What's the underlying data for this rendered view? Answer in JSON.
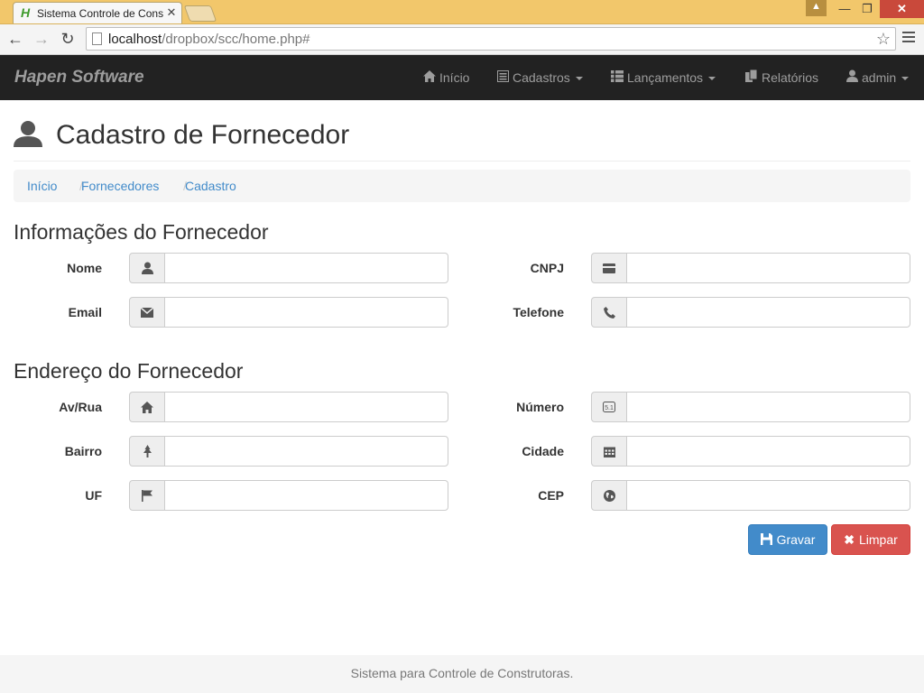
{
  "browser": {
    "tab_title": "Sistema Controle de Cons",
    "tab_favicon": "H",
    "url_host": "localhost",
    "url_path": "/dropbox/scc/home.php#"
  },
  "navbar": {
    "brand": "Hapen Software",
    "items": [
      {
        "label": "Início",
        "icon": "home-icon"
      },
      {
        "label": "Cadastros",
        "icon": "list-alt-icon"
      },
      {
        "label": "Lançamentos",
        "icon": "th-list-icon"
      },
      {
        "label": "Relatórios",
        "icon": "duplicate-icon"
      },
      {
        "label": "admin",
        "icon": "user-icon"
      }
    ]
  },
  "page": {
    "title": "Cadastro de Fornecedor"
  },
  "breadcrumb": [
    "Início",
    "Fornecedores",
    "Cadastro"
  ],
  "sections": {
    "info_title": "Informações do Fornecedor",
    "address_title": "Endereço do Fornecedor"
  },
  "fields": {
    "nome": {
      "label": "Nome",
      "value": "",
      "icon": "user-icon"
    },
    "cnpj": {
      "label": "CNPJ",
      "value": "",
      "icon": "credit-card-icon"
    },
    "email": {
      "label": "Email",
      "value": "",
      "icon": "envelope-icon"
    },
    "telefone": {
      "label": "Telefone",
      "value": "",
      "icon": "phone-icon"
    },
    "rua": {
      "label": "Av/Rua",
      "value": "",
      "icon": "home-icon"
    },
    "numero": {
      "label": "Número",
      "value": "",
      "icon": "sound-5-1-icon"
    },
    "bairro": {
      "label": "Bairro",
      "value": "",
      "icon": "tree-icon"
    },
    "cidade": {
      "label": "Cidade",
      "value": "",
      "icon": "calendar-icon"
    },
    "uf": {
      "label": "UF",
      "value": "",
      "icon": "flag-icon"
    },
    "cep": {
      "label": "CEP",
      "value": "",
      "icon": "globe-icon"
    }
  },
  "buttons": {
    "save": "Gravar",
    "clear": "Limpar"
  },
  "footer": {
    "text": "Sistema para Controle de Construtoras."
  },
  "colors": {
    "navbar_bg": "#222222",
    "primary": "#428bca",
    "danger": "#d9534f",
    "link": "#428bca"
  }
}
